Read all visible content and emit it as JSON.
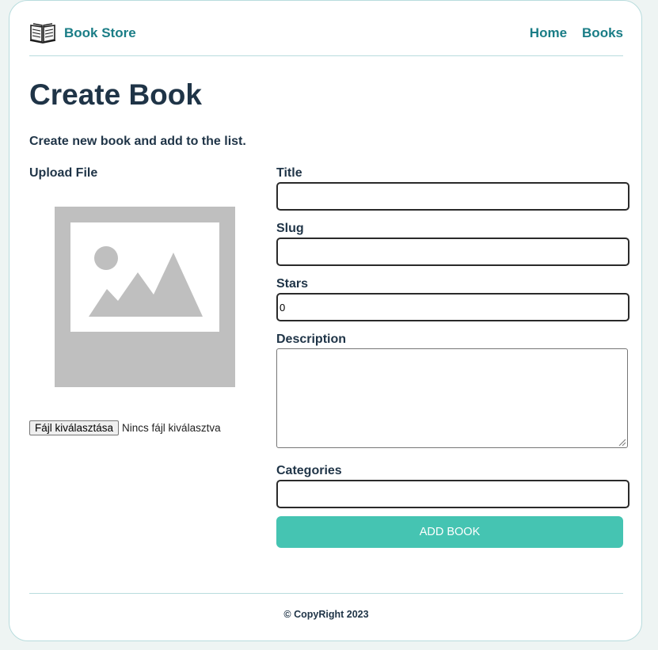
{
  "header": {
    "brand": "Book Store",
    "nav": [
      {
        "label": "Home"
      },
      {
        "label": "Books"
      }
    ]
  },
  "page": {
    "title": "Create Book",
    "subtitle": "Create new book and add to the list."
  },
  "upload": {
    "label": "Upload File",
    "button_label": "Fájl kiválasztása",
    "status": "Nincs fájl kiválasztva"
  },
  "form": {
    "title_label": "Title",
    "title_value": "",
    "slug_label": "Slug",
    "slug_value": "",
    "stars_label": "Stars",
    "stars_value": "0",
    "description_label": "Description",
    "description_value": "",
    "categories_label": "Categories",
    "categories_value": "",
    "submit_label": "ADD BOOK"
  },
  "footer": {
    "copyright": "© CopyRight 2023"
  },
  "colors": {
    "accent": "#1a7d86",
    "button": "#45c4b2",
    "text": "#1f3447",
    "border": "#b8dcdd",
    "background": "#eef4f3",
    "placeholder": "#bfbfbf"
  }
}
